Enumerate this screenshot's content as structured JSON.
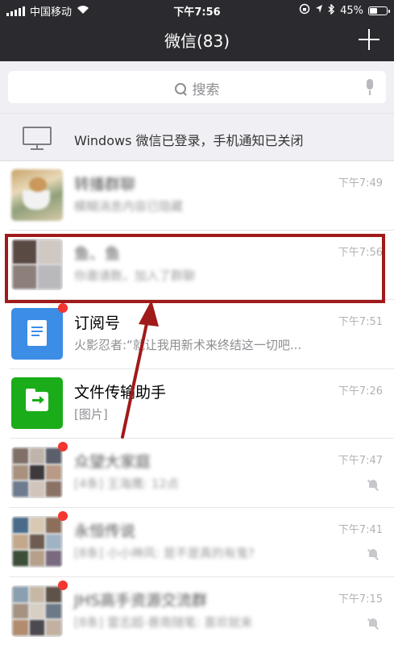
{
  "status_bar": {
    "carrier": "中国移动",
    "time": "下午7:56",
    "battery": "45%",
    "battery_level": 0.45
  },
  "nav": {
    "title": "微信(83)"
  },
  "search": {
    "placeholder": "搜索"
  },
  "notice": {
    "text": "Windows 微信已登录，手机通知已关闭"
  },
  "chats": [
    {
      "name": "转播群聊",
      "preview": "模糊消息内容已隐藏",
      "time": "下午7:49",
      "blurred": true,
      "unread": false,
      "muted": false
    },
    {
      "name": "鱼、鱼",
      "preview": "你邀请数，加入了群聊",
      "time": "下午7:56",
      "blurred": true,
      "unread": false,
      "muted": false
    },
    {
      "name": "订阅号",
      "preview": "火影忍者:“就让我用新术来终结这一切吧...",
      "time": "下午7:51",
      "blurred": false,
      "unread": true,
      "muted": false
    },
    {
      "name": "文件传输助手",
      "preview": "[图片]",
      "time": "下午7:26",
      "blurred": false,
      "unread": false,
      "muted": false
    },
    {
      "name": "众望大家庭",
      "preview": "[4条] 王海鹰: 12点",
      "time": "下午7:47",
      "blurred": true,
      "unread": true,
      "muted": true
    },
    {
      "name": "永恒传说",
      "preview": "[8条] 小小神风: 是不是真的有鬼?",
      "time": "下午7:41",
      "blurred": true,
      "unread": true,
      "muted": true
    },
    {
      "name": "JHS高手资源交流群",
      "preview": "[8条] 雷志超-普南随笔: 喜欢就来",
      "time": "下午7:15",
      "blurred": true,
      "unread": true,
      "muted": true
    }
  ],
  "colors": {
    "nav_bg": "#2b2a2f",
    "subscription_icon": "#3b8de6",
    "file_transfer_icon": "#1aad19",
    "annotation": "#a11a1a",
    "unread_dot": "#f43530"
  }
}
